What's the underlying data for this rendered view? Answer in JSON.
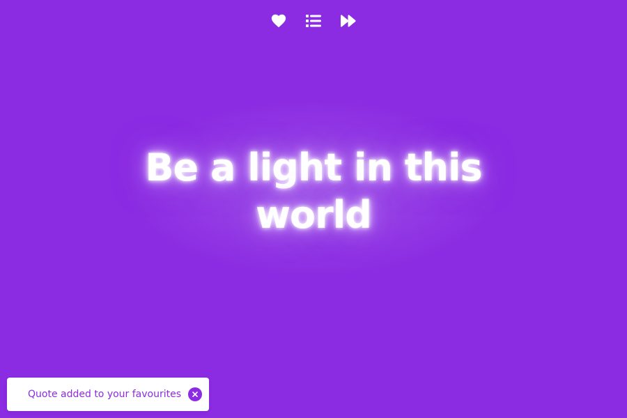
{
  "theme": {
    "background": "#8b2be2",
    "icon_color": "#ffffff",
    "toast_text_color": "#8b2be2",
    "toast_close_bg": "#8b2be2"
  },
  "toolbar": {
    "icons": [
      "heart-icon",
      "list-icon",
      "fast-forward-icon"
    ]
  },
  "quote": {
    "text": "Be a light in this world"
  },
  "toast": {
    "message": "Quote added to your favourites",
    "close_glyph": "×"
  }
}
